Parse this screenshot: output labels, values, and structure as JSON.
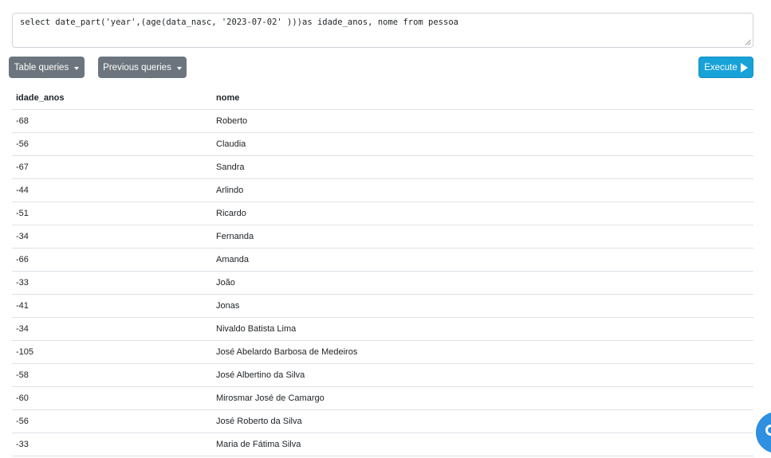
{
  "query": {
    "text": "select date_part('year',(age(data_nasc, '2023-07-02' )))as idade_anos, nome from pessoa"
  },
  "toolbar": {
    "table_queries_label": "Table queries",
    "previous_queries_label": "Previous queries",
    "execute_label": "Execute"
  },
  "results": {
    "columns": [
      "idade_anos",
      "nome"
    ],
    "rows": [
      [
        "-68",
        "Roberto"
      ],
      [
        "-56",
        "Claudia"
      ],
      [
        "-67",
        "Sandra"
      ],
      [
        "-44",
        "Arlindo"
      ],
      [
        "-51",
        "Ricardo"
      ],
      [
        "-34",
        "Fernanda"
      ],
      [
        "-66",
        "Amanda"
      ],
      [
        "-33",
        "João"
      ],
      [
        "-41",
        "Jonas"
      ],
      [
        "-34",
        "Nivaldo Batista Lima"
      ],
      [
        "-105",
        "José Abelardo Barbosa de Medeiros"
      ],
      [
        "-58",
        "José Albertino da Silva"
      ],
      [
        "-60",
        "Mirosmar José de Camargo"
      ],
      [
        "-56",
        "José Roberto da Silva"
      ],
      [
        "-33",
        "Maria de Fátima Silva"
      ]
    ]
  },
  "icons": {
    "dropdown": "caret-down-icon",
    "execute": "play-icon",
    "fab": "chat-icon"
  },
  "colors": {
    "secondary_button": "#6c757d",
    "primary_button": "#17a2d8",
    "fab": "#2f8fe0"
  }
}
